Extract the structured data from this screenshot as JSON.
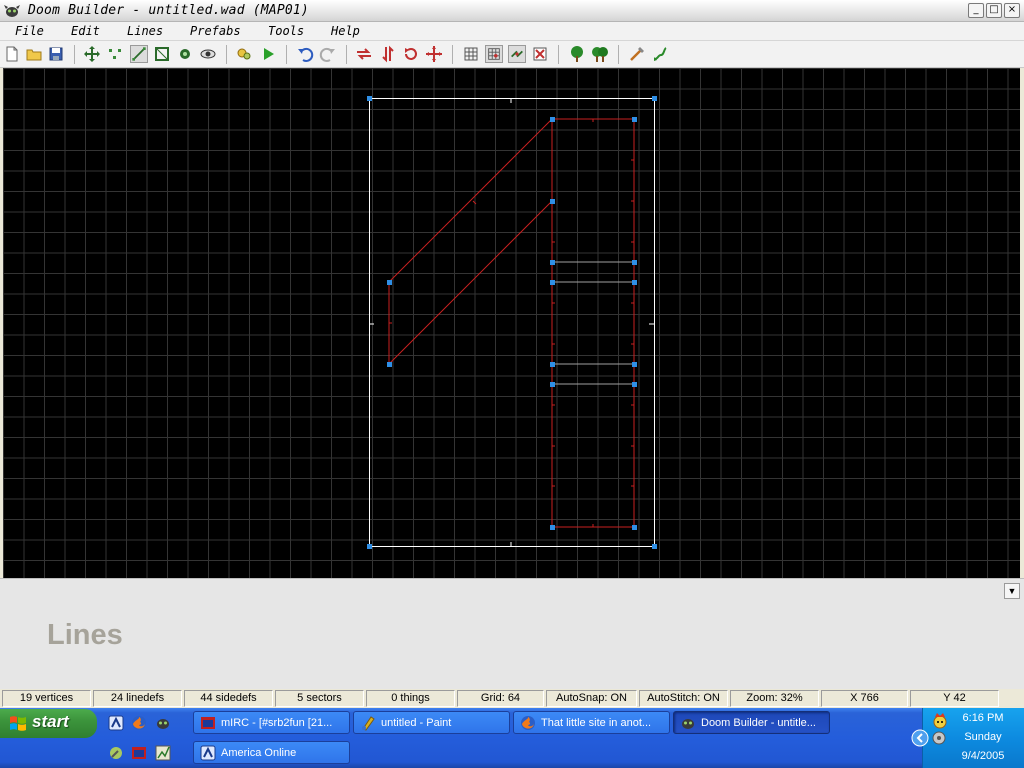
{
  "window": {
    "title": "Doom Builder - untitled.wad (MAP01)",
    "controls": {
      "minimize": "_",
      "maximize": "□",
      "close": "×"
    }
  },
  "menu": [
    "File",
    "Edit",
    "Lines",
    "Prefabs",
    "Tools",
    "Help"
  ],
  "toolbar": {
    "buttons": [
      "new-map",
      "open-map",
      "save-map",
      "pan-mode",
      "vertices-mode",
      "lines-mode",
      "sectors-mode",
      "things-mode",
      "3d-mode",
      "build-nodes",
      "test-map",
      "undo",
      "redo",
      "flip-lines",
      "flip-vertical",
      "rotate",
      "scale",
      "toggle-grid",
      "snap-grid",
      "stitch",
      "clear",
      "prefab-tree",
      "prefab-trees",
      "tools",
      "script"
    ],
    "pressed": [
      "lines-mode",
      "snap-grid",
      "stitch"
    ]
  },
  "info_panel": {
    "mode_label": "Lines",
    "dropdown_glyph": "▼"
  },
  "status": {
    "vertices": "19 vertices",
    "linedefs": "24 linedefs",
    "sidedefs": "44 sidedefs",
    "sectors": "5 sectors",
    "things": "0 things",
    "grid": "Grid: 64",
    "autosnap": "AutoSnap: ON",
    "autostitch": "AutoStitch: ON",
    "zoom": "Zoom: 32%",
    "x": "X 766",
    "y": "Y 42"
  },
  "taskbar": {
    "start_label": "start",
    "tasks": [
      {
        "label": "mIRC - [#srb2fun [21...",
        "icon": "mirc-icon",
        "active": false
      },
      {
        "label": "untitled - Paint",
        "icon": "paint-icon",
        "active": false
      },
      {
        "label": "That little site in anot...",
        "icon": "firefox-icon",
        "active": false
      },
      {
        "label": "Doom Builder - untitle...",
        "icon": "doom-builder-icon",
        "active": true
      },
      {
        "label": "America  Online",
        "icon": "aol-icon",
        "active": false
      }
    ],
    "quick_launch": [
      "aol-icon",
      "firefox-icon",
      "doom-builder-icon",
      "wrench-icon",
      "mirc-icon",
      "chart-icon"
    ],
    "clock": {
      "time": "6:16 PM",
      "day": "Sunday",
      "date": "9/4/2005"
    }
  },
  "colors": {
    "map_background": "#000000",
    "grid_line": "#343434",
    "linedef_one_sided": "#ffffff",
    "linedef_two_sided": "#c82020",
    "linedef_inner": "#a0a0a0",
    "vertex": "#2f8fe6",
    "taskbar": "#245ddb",
    "start_button": "#3c943c"
  }
}
